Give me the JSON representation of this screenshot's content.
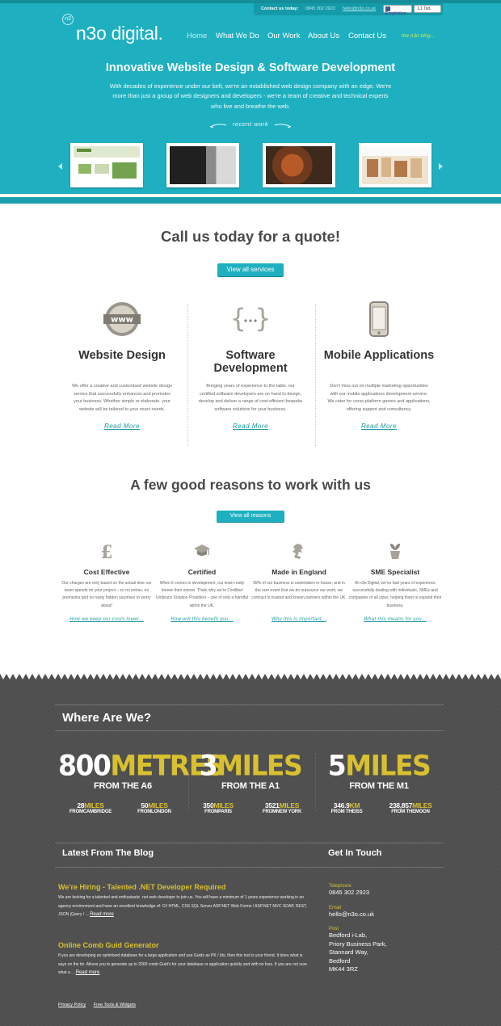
{
  "colors": {
    "teal": "#1eb0c0",
    "teal_dark": "#1a9fae",
    "footer_bg": "#4e4e4e",
    "accent_yellow": "#d8c030",
    "nav_blog": "#d6e84a"
  },
  "topbar": {
    "contact_label": "Contact us today:",
    "phone": "0845 302 2923",
    "email": "hello@n3o.co.uk",
    "fb_like": "Empfehlen",
    "fb_count": "1,1 Tsd."
  },
  "logo": {
    "mark": "n3",
    "text": "n3o digital."
  },
  "nav": {
    "items": [
      "Home",
      "What We Do",
      "Our Work",
      "About Us",
      "Contact Us"
    ],
    "active": "Home",
    "blog": "the n3o blog..."
  },
  "hero": {
    "title": "Innovative Website Design & Software Development",
    "text": "With decades of experience under our belt, we're an established web design company with an edge. We're more than just a group of web designers and developers - we're a team of creative and technical experts who live and breathe the web.",
    "recent_label": "recent work"
  },
  "quote": {
    "title": "Call us today for a quote!",
    "button": "View all services"
  },
  "services": [
    {
      "title": "Website Design",
      "icon": "www-badge-icon",
      "text": "We offer a creative and customised website design service that successfully enhances and promotes your business. Whether simple or elaborate, your website will be tailored to your exact needs.",
      "more": "Read More"
    },
    {
      "title": "Software Development",
      "icon": "curly-braces-icon",
      "text": "Bringing years of experience to the table, our certified software developers are on hand to design, develop and deliver a range of cost-efficient bespoke software solutions for your business.",
      "more": "Read More"
    },
    {
      "title": "Mobile Applications",
      "icon": "mobile-phone-icon",
      "text": "Don't miss out on multiple marketing opportunities with our mobile applications development service. We cater for cross-platform games and applications, offering support and consultancy.",
      "more": "Read More"
    }
  ],
  "reasons": {
    "title": "A few good reasons to work with us",
    "button": "View all reasons",
    "items": [
      {
        "title": "Cost Effective",
        "icon": "pound-sign-icon",
        "text": "Our charges are only based on the actual time our team spends on your project – so no extras, no premiums and no nasty hidden surprises to worry about!",
        "more": "How we keep our costs lower..."
      },
      {
        "title": "Certified",
        "icon": "graduation-cap-icon",
        "text": "When it comes to development, our team really knows their onions. Thats why we're Certified Umbraco Solution Providers – one of only a handful within the UK.",
        "more": "How will this benefit you..."
      },
      {
        "title": "Made in England",
        "icon": "england-lion-icon",
        "text": "99% of our business is undertaken in-house, and in the rare event that we do outsource our work, we contract to trusted and known partners within the UK.",
        "more": "Why this is important..."
      },
      {
        "title": "SME Specialist",
        "icon": "plant-pot-icon",
        "text": "At n3o Digital, we've had years of experience successfully dealing with individuals, SMEs and companies of all sizes, helping them to expand their business.",
        "more": "What this means for you..."
      }
    ]
  },
  "where": {
    "title": "Where Are We?",
    "main": [
      {
        "value": "800",
        "unit": "METRES",
        "from": "FROM THE A6"
      },
      {
        "value": "3",
        "unit": "MILES",
        "from": "FROM THE A1"
      },
      {
        "value": "5",
        "unit": "MILES",
        "from": "FROM THE M1"
      }
    ],
    "secondary": [
      {
        "value": "28",
        "unit": "MILES",
        "from": "FROMCAMBRIDGE"
      },
      {
        "value": "50",
        "unit": "MILES",
        "from": "FROMLONDON"
      },
      {
        "value": "350",
        "unit": "MILES",
        "from": "FROMPARIS"
      },
      {
        "value": "3521",
        "unit": "MILES",
        "from": "FROMNEW YORK"
      },
      {
        "value": "346.9",
        "unit": "KM",
        "from": "FROM THEISS"
      },
      {
        "value": "238,857",
        "unit": "MILES",
        "from": "FROM THEMOON"
      }
    ]
  },
  "blog": {
    "title": "Latest From The Blog",
    "posts": [
      {
        "title": "We're Hiring - Talented .NET Developer Required",
        "text": "We are looking for a talented and enthusiastic .net web developer to join us. You will have a minimum of 1 years experience working in an agency environment and have an excellent knowledge of: C# HTML, CSS SQL Server ASP.NET Web Forms / ASP.NET MVC SOAP, REST, JSON jQuery / ...",
        "more": "Read more"
      },
      {
        "title": "Online Comb Guid Generator",
        "text": "If you are developing an optimised database for a large application and use Guids as PK / Ids, then this tool is your friend. It does what is says on the tin. Allows you to generate up to 2000 comb Guid's for your database or application quickly and with no fuss. If you are not sure what a ...",
        "more": "Read more"
      }
    ]
  },
  "contact": {
    "title": "Get In Touch",
    "telephone_label": "Telephone",
    "telephone": "0845 302 2923",
    "email_label": "Email",
    "email": "hello@n3o.co.uk",
    "post_label": "Post",
    "address": [
      "Bedford i-Lab,",
      "Priory Business Park,",
      "Stannard Way,",
      "Bedford",
      "MK44 3RZ"
    ]
  },
  "footer_links": [
    "Privacy Policy",
    "Free Tools & Widgets"
  ]
}
